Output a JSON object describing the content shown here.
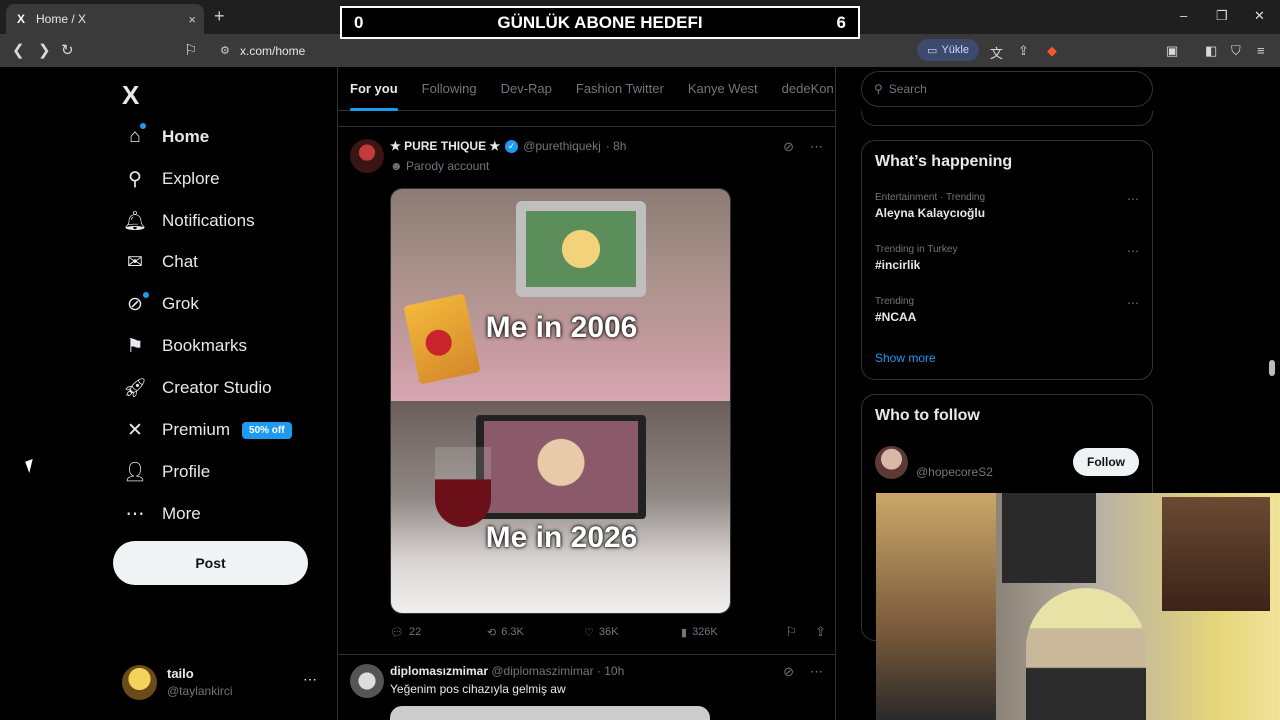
{
  "browser": {
    "tab_title": "Home / X",
    "tab_favicon": "X",
    "tab_close": "×",
    "new_tab": "+",
    "url": "x.com/home",
    "translate_label": "Yükle",
    "window_controls": [
      "–",
      "❐",
      "✕"
    ]
  },
  "overlay": {
    "left_count": "0",
    "title": "GÜNLÜK ABONE HEDEFI",
    "right_count": "6"
  },
  "sidebar": {
    "logo": "X",
    "items": [
      {
        "label": "Home",
        "icon": "home-icon",
        "glyph": "⌂"
      },
      {
        "label": "Explore",
        "icon": "search-icon",
        "glyph": "⚲"
      },
      {
        "label": "Notifications",
        "icon": "bell-icon",
        "glyph": "🔔︎"
      },
      {
        "label": "Chat",
        "icon": "mail-icon",
        "glyph": "✉"
      },
      {
        "label": "Grok",
        "icon": "grok-icon",
        "glyph": "⊘"
      },
      {
        "label": "Bookmarks",
        "icon": "bookmark-icon",
        "glyph": "⚑"
      },
      {
        "label": "Creator Studio",
        "icon": "rocket-icon",
        "glyph": "🚀︎"
      },
      {
        "label": "Premium",
        "icon": "x-icon",
        "glyph": "✕"
      },
      {
        "label": "Profile",
        "icon": "person-icon",
        "glyph": "👤︎"
      },
      {
        "label": "More",
        "icon": "more-circle-icon",
        "glyph": "⋯"
      }
    ],
    "premium_badge": "50% off",
    "post_label": "Post",
    "account": {
      "name": "tailo",
      "handle": "@taylankirci",
      "more": "⋯"
    }
  },
  "feed": {
    "tabs": [
      "For you",
      "Following",
      "Dev-Rap",
      "Fashion Twitter",
      "Kanye West",
      "dedeKon"
    ],
    "tweet1": {
      "name": "★ PURE THIQUE ★",
      "handle": "@purethiquekj",
      "time": "· 8h",
      "label": "Parody account",
      "caption_top": "Me in 2006",
      "caption_bottom": "Me in 2026",
      "replies": "22",
      "reposts": "6.3K",
      "likes": "36K",
      "views": "326K"
    },
    "tweet2": {
      "name": "diplomasızmimar",
      "handle": "@diplomaszimimar",
      "time": "· 10h",
      "text": "Yeğenim pos cihazıyla gelmiş aw"
    }
  },
  "right": {
    "search_placeholder": "Search",
    "whats_happening_title": "What’s happening",
    "trends": [
      {
        "context": "Entertainment · Trending",
        "name": "Aleyna Kalaycıoğlu"
      },
      {
        "context": "Trending in Turkey",
        "name": "#incirlik"
      },
      {
        "context": "Trending",
        "name": "#NCAA"
      }
    ],
    "show_more": "Show more",
    "who_to_follow_title": "Who to follow",
    "suggestion_handle": "@hopecoreS2",
    "follow_label": "Follow"
  },
  "colors": {
    "accent": "#1d9bf0",
    "background": "#000000",
    "border": "#2f3336"
  }
}
